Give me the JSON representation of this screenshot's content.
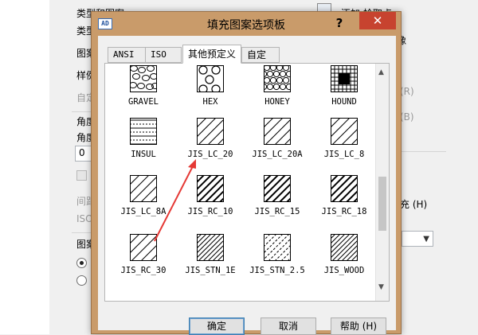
{
  "background": {
    "field_labels": {
      "type_and_pattern": "类型和图案",
      "type": "类型",
      "pattern": "图案",
      "style": "样例",
      "custom": "自定",
      "angle_group": "角度",
      "angle": "角度",
      "angle_value": "0",
      "spacing": "间距",
      "iso": "ISO",
      "boundary": "图案",
      "add_pick_point": "添加:拾取点",
      "image_label": "像",
      "fill_option": "填充 (H)",
      "hotkey_r": "(R)",
      "hotkey_b": "(B)"
    }
  },
  "dialog": {
    "title": "填充图案选项板",
    "help_glyph": "?",
    "close_glyph": "✕",
    "tabs": [
      {
        "label": "ANSI",
        "active": false
      },
      {
        "label": "ISO",
        "active": false
      },
      {
        "label": "其他预定义",
        "active": true
      },
      {
        "label": "自定义",
        "active": false
      }
    ],
    "patterns": [
      {
        "name": "GRAVEL",
        "kind": "gravel"
      },
      {
        "name": "HEX",
        "kind": "hex"
      },
      {
        "name": "HONEY",
        "kind": "honey"
      },
      {
        "name": "HOUND",
        "kind": "hound"
      },
      {
        "name": "INSUL",
        "kind": "insul"
      },
      {
        "name": "JIS_LC_20",
        "kind": "diag-thin"
      },
      {
        "name": "JIS_LC_20A",
        "kind": "diag-thin"
      },
      {
        "name": "JIS_LC_8",
        "kind": "diag-thin"
      },
      {
        "name": "JIS_LC_8A",
        "kind": "diag-thin"
      },
      {
        "name": "JIS_RC_10",
        "kind": "diag-thick"
      },
      {
        "name": "JIS_RC_15",
        "kind": "diag-thick"
      },
      {
        "name": "JIS_RC_18",
        "kind": "diag-thick"
      },
      {
        "name": "JIS_RC_30",
        "kind": "diag-thin"
      },
      {
        "name": "JIS_STN_1E",
        "kind": "diag-dense"
      },
      {
        "name": "JIS_STN_2.5",
        "kind": "diag-dashed"
      },
      {
        "name": "JIS_WOOD",
        "kind": "diag-dense"
      }
    ],
    "buttons": {
      "ok": "确定",
      "cancel": "取消",
      "help": "帮助 (H)"
    }
  },
  "colors": {
    "dialog_frame": "#c99b6a",
    "close_button": "#c7432f",
    "annotation_arrow": "#e53935"
  }
}
